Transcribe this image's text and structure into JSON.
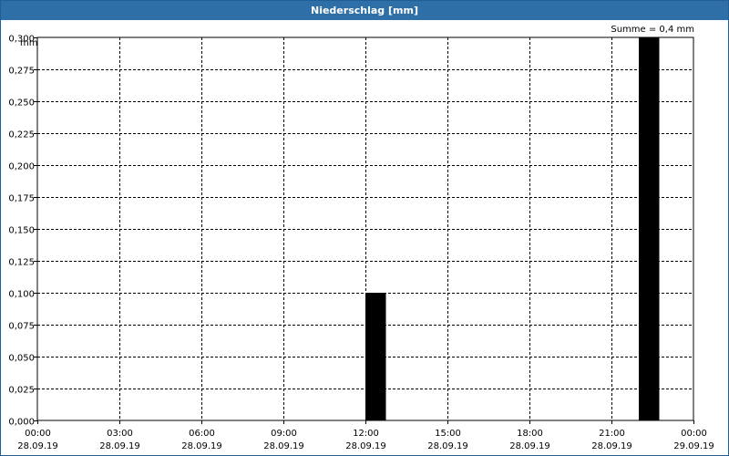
{
  "window": {
    "title": "Niederschlag [mm]"
  },
  "chart_data": {
    "type": "bar",
    "title": "Niederschlag [mm]",
    "ylabel": "mm",
    "annotation": "Summe = 0,4 mm",
    "ylim": [
      0,
      0.3
    ],
    "y_ticks": [
      "0,000",
      "0,025",
      "0,050",
      "0,075",
      "0,100",
      "0,125",
      "0,150",
      "0,175",
      "0,200",
      "0,225",
      "0,250",
      "0,275",
      "0,300"
    ],
    "x_ticks": [
      {
        "time": "00:00",
        "date": "28.09.19"
      },
      {
        "time": "03:00",
        "date": "28.09.19"
      },
      {
        "time": "06:00",
        "date": "28.09.19"
      },
      {
        "time": "09:00",
        "date": "28.09.19"
      },
      {
        "time": "12:00",
        "date": "28.09.19"
      },
      {
        "time": "15:00",
        "date": "28.09.19"
      },
      {
        "time": "18:00",
        "date": "28.09.19"
      },
      {
        "time": "21:00",
        "date": "28.09.19"
      },
      {
        "time": "00:00",
        "date": "29.09.19"
      }
    ],
    "series": [
      {
        "bars": [
          {
            "start": "28.09.19 12:00",
            "end": "28.09.19 12:45",
            "value": 0.1
          },
          {
            "start": "28.09.19 22:00",
            "end": "28.09.19 22:45",
            "value": 0.3
          }
        ]
      }
    ],
    "grid": true,
    "bar_color": "#000000"
  }
}
